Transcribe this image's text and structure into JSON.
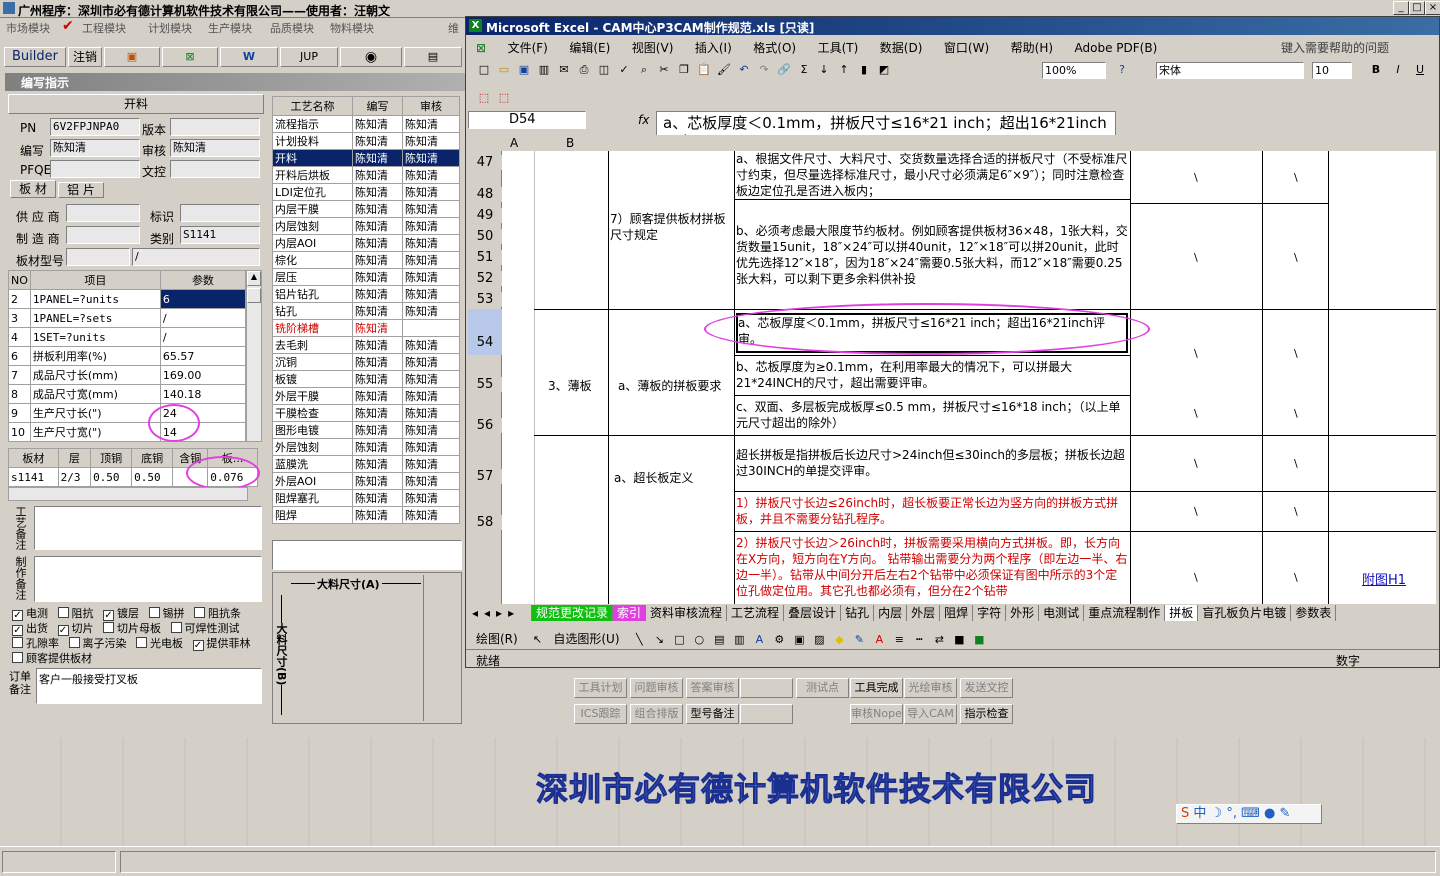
{
  "app": {
    "title": "广州程序：深圳市必有德计算机软件技术有限公司——使用者：汪朝文",
    "menus": [
      "市场模块",
      "工程模块",
      "计划模块",
      "生产模块",
      "品质模块",
      "物料模块",
      "维"
    ],
    "toolbar": [
      "Builder",
      "注销",
      "JUP"
    ],
    "footer_company": "深圳市必有德计算机软件技术有限公司"
  },
  "left": {
    "panel_title": "编写指示",
    "section": "开料",
    "pn_label": "PN",
    "pn": "6V2FPJNPA0",
    "version_label": "版本",
    "version": "",
    "writer_label": "编写",
    "writer": "陈知清",
    "reviewer_label": "审核",
    "reviewer": "陈知清",
    "pfqe_label": "PFQE",
    "wenkong_label": "文控",
    "tabs": [
      "板 材",
      "铝 片"
    ],
    "supplier_label": "供 应 商",
    "tag_label": "标识",
    "maker_label": "制 造 商",
    "category_label": "类别",
    "category": "S1141",
    "board_type_label": "板材型号",
    "board_type": "/",
    "param_headers": [
      "NO",
      "项目",
      "参数"
    ],
    "params": [
      [
        "2",
        "1PANEL=?units",
        "6"
      ],
      [
        "3",
        "1PANEL=?sets",
        "/"
      ],
      [
        "4",
        "1SET=?units",
        "/"
      ],
      [
        "6",
        "拼板利用率(%)",
        "65.57"
      ],
      [
        "7",
        "成品尺寸长(mm)",
        "169.00"
      ],
      [
        "8",
        "成品尺寸宽(mm)",
        "140.18"
      ],
      [
        "9",
        "生产尺寸长(\")",
        "24"
      ],
      [
        "10",
        "生产尺寸宽(\")",
        "14"
      ]
    ],
    "mat_headers": [
      "板材",
      "层",
      "顶铜",
      "底铜",
      "含铜",
      "板..."
    ],
    "mat_row": [
      "s1141",
      "2/3",
      "0.50",
      "0.50",
      "",
      "0.076"
    ],
    "remark_label": "工艺备注",
    "notes_label": "制作备注",
    "checks": [
      [
        "电测",
        true
      ],
      [
        "阻抗",
        false
      ],
      [
        "镀层",
        true
      ],
      [
        "锡拼",
        false
      ],
      [
        "阻抗条",
        false
      ],
      [
        "出货",
        true
      ],
      [
        "切片",
        true
      ],
      [
        "切片母板",
        false
      ],
      [
        "可焊性测试",
        false
      ],
      [
        "孔隙率",
        false
      ],
      [
        "离子污染",
        false
      ],
      [
        "光电板",
        false
      ],
      [
        "提供菲林",
        true
      ],
      [
        "顾客提供板材",
        false
      ]
    ],
    "order_label": "订单备注",
    "order_note": "客户一般接受打叉板"
  },
  "mid": {
    "headers": [
      "工艺名称",
      "编写",
      "审核"
    ],
    "rows": [
      [
        "流程指示",
        "陈知清",
        "陈知清"
      ],
      [
        "计划投料",
        "陈知清",
        "陈知清"
      ],
      [
        "开料",
        "陈知清",
        "陈知清"
      ],
      [
        "开料后烘板",
        "陈知清",
        "陈知清"
      ],
      [
        "LDI定位孔",
        "陈知清",
        "陈知清"
      ],
      [
        "内层干膜",
        "陈知清",
        "陈知清"
      ],
      [
        "内层蚀刻",
        "陈知清",
        "陈知清"
      ],
      [
        "内层AOI",
        "陈知清",
        "陈知清"
      ],
      [
        "棕化",
        "陈知清",
        "陈知清"
      ],
      [
        "层压",
        "陈知清",
        "陈知清"
      ],
      [
        "铝片钻孔",
        "陈知清",
        "陈知清"
      ],
      [
        "钻孔",
        "陈知清",
        "陈知清"
      ],
      [
        "铣阶梯槽",
        "陈知清",
        ""
      ],
      [
        "去毛刺",
        "陈知清",
        "陈知清"
      ],
      [
        "沉铜",
        "陈知清",
        "陈知清"
      ],
      [
        "板镀",
        "陈知清",
        "陈知清"
      ],
      [
        "外层干膜",
        "陈知清",
        "陈知清"
      ],
      [
        "干膜检查",
        "陈知清",
        "陈知清"
      ],
      [
        "图形电镀",
        "陈知清",
        "陈知清"
      ],
      [
        "外层蚀刻",
        "陈知清",
        "陈知清"
      ],
      [
        "蓝膜洗",
        "陈知清",
        "陈知清"
      ],
      [
        "外层AOI",
        "陈知清",
        "陈知清"
      ],
      [
        "阻焊塞孔",
        "陈知清",
        "陈知清"
      ],
      [
        "阻焊",
        "陈知清",
        "陈知清"
      ]
    ],
    "dia_a": "大料尺寸(A)",
    "dia_b": "大料尺寸(B)"
  },
  "bottom_buttons": [
    [
      "工具计划",
      "问题审核",
      "答案审核",
      "",
      "测试点",
      "工具完成",
      "光绘审核",
      "发送文控"
    ],
    [
      "ICS跟踪",
      "组合排版",
      "型号备注",
      "",
      "审核Nope",
      "导入CAM",
      "指示检查",
      ""
    ]
  ],
  "excel": {
    "title": "Microsoft Excel - CAM中心P3CAM制作规范.xls [只读]",
    "menus": [
      "文件(F)",
      "编辑(E)",
      "视图(V)",
      "插入(I)",
      "格式(O)",
      "工具(T)",
      "数据(D)",
      "窗口(W)",
      "帮助(H)",
      "Adobe PDF(B)"
    ],
    "help_placeholder": "键入需要帮助的问题",
    "zoom": "100%",
    "font": "宋体",
    "size": "10",
    "cellref": "D54",
    "formula": "a、芯板厚度＜0.1mm，拼板尺寸≤16*21 inch；超出16*21inch 评审。",
    "cols": [
      "A",
      "B"
    ],
    "rows_nums": [
      "47",
      "48",
      "49",
      "50",
      "51",
      "52",
      "53",
      "54",
      "55",
      "56",
      "57",
      "58"
    ],
    "c_7": "7）顾客提供板材拼板尺寸规定",
    "c_3": "3、薄板",
    "c_3a": "a、薄板的拼板要求",
    "c_chao": "a、超长板定义",
    "d47": "a、根据文件尺寸、大料尺寸、交货数量选择合适的拼板尺寸（不受标准尺寸约束，但尽量选择标准尺寸，最小尺寸必须满足6″×9″）；同时注意检查板边定位孔是否进入板内；",
    "d50": "b、必须考虑最大限度节约板材。例如顾客提供板材36×48，1张大料，交货数量15unit，18″×24″可以拼40unit，12″×18″可以拼20unit，此时优先选择12″×18″，因为18″×24″需要0.5张大料，而12″×18″需要0.25张大料，可以剩下更多余料供补投",
    "d54": "a、芯板厚度＜0.1mm，拼板尺寸≤16*21 inch；超出16*21inch评审。",
    "d55": "b、芯板厚度为≥0.1mm，在利用率最大的情况下，可以拼最大21*24INCH的尺寸，超出需要评审。",
    "d56": "c、双面、多层板完成板厚≤0.5 mm，拼板尺寸≤16*18 inch；（以上单元尺寸超出的除外）",
    "d57": "超长拼板是指拼板后长边尺寸>24inch但≤30inch的多层板；拼板长边超过30INCH的单提交评审。",
    "d58a": "1）拼板尺寸长边≤26inch时，超长板要正常长边为竖方向的拼板方式拼板，并且不需要分钻孔程序。",
    "d58b": "2）拼板尺寸长边＞26inch时，拼板需要采用横向方式拼板。即，长方向在X方向，短方向在Y方向。 钻带输出需要分为两个程序（即左边一半、右边一半）。钻带从中间分开后左右2个钻带中必须保证有图中所示的3个定位孔做定位用。其它孔也都必须有，但分在2个钻带",
    "slash": "\\",
    "link": "附图H1",
    "sheets": [
      "规范更改记录",
      "索引",
      "资料审核流程",
      "工艺流程",
      "叠层设计",
      "钻孔",
      "内层",
      "外层",
      "阻焊",
      "字符",
      "外形",
      "电测试",
      "重点流程制作",
      "拼板",
      "盲孔板负片电镀",
      "参数表"
    ],
    "draw_label": "绘图(R)",
    "autoshape": "自选图形(U)",
    "status_ready": "就绪",
    "status_num": "数字"
  },
  "colors": {
    "selection": "#0a246a",
    "accent_red": "#d00000",
    "company_text": "#5a6fd0",
    "highlight_ellipse": "#e040e0"
  }
}
